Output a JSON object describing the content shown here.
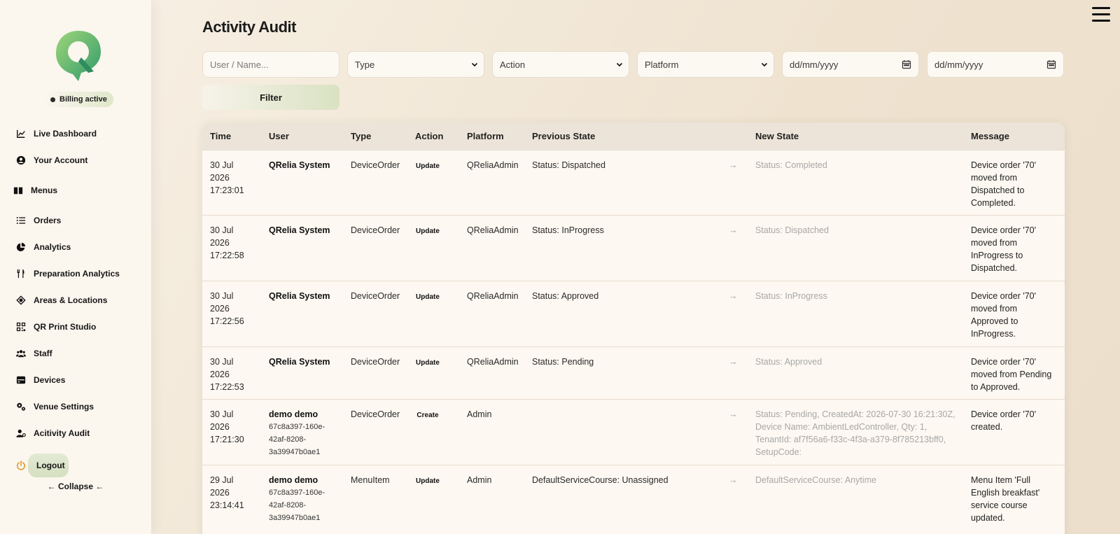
{
  "sidebar": {
    "billing_label": "Billing active",
    "nav": [
      {
        "label": "Live Dashboard",
        "icon": "chart-line-icon"
      },
      {
        "label": "Your Account",
        "icon": "user-circle-icon"
      },
      {
        "label": "Menus",
        "icon": "book-open-icon"
      },
      {
        "label": "Orders",
        "icon": "list-icon"
      },
      {
        "label": "Analytics",
        "icon": "pie-chart-icon"
      },
      {
        "label": "Preparation Analytics",
        "icon": "utensils-icon"
      },
      {
        "label": "Areas & Locations",
        "icon": "location-crosshair-icon"
      },
      {
        "label": "QR Print Studio",
        "icon": "qr-code-icon"
      },
      {
        "label": "Staff",
        "icon": "users-icon"
      },
      {
        "label": "Devices",
        "icon": "device-icon"
      },
      {
        "label": "Venue Settings",
        "icon": "gears-icon"
      },
      {
        "label": "Acitivity Audit",
        "icon": "user-audit-icon"
      },
      {
        "label": "Logout",
        "icon": "power-icon"
      }
    ],
    "collapse_label": "← Collapse ←"
  },
  "page": {
    "title": "Activity Audit"
  },
  "filters": {
    "user_placeholder": "User / Name...",
    "type_selected": "Type",
    "action_selected": "Action",
    "platform_selected": "Platform",
    "date_from_placeholder": "dd/mm/yyyy",
    "date_to_placeholder": "dd/mm/yyyy",
    "filter_button": "Filter"
  },
  "table": {
    "columns": [
      "Time",
      "User",
      "Type",
      "Action",
      "Platform",
      "Previous State",
      "New State",
      "Message"
    ],
    "arrow": "→",
    "rows": [
      {
        "time": [
          "30 Jul",
          "2026",
          "17:23:01"
        ],
        "user": "QRelia System",
        "user_id": [],
        "type": "DeviceOrder",
        "action": "Update",
        "platform": "QReliaAdmin",
        "previous": "Status: Dispatched",
        "new": "Status: Completed",
        "message": "Device order '70' moved from Dispatched to Completed."
      },
      {
        "time": [
          "30 Jul",
          "2026",
          "17:22:58"
        ],
        "user": "QRelia System",
        "user_id": [],
        "type": "DeviceOrder",
        "action": "Update",
        "platform": "QReliaAdmin",
        "previous": "Status: InProgress",
        "new": "Status: Dispatched",
        "message": "Device order '70' moved from InProgress to Dispatched."
      },
      {
        "time": [
          "30 Jul",
          "2026",
          "17:22:56"
        ],
        "user": "QRelia System",
        "user_id": [],
        "type": "DeviceOrder",
        "action": "Update",
        "platform": "QReliaAdmin",
        "previous": "Status: Approved",
        "new": "Status: InProgress",
        "message": "Device order '70' moved from Approved to InProgress."
      },
      {
        "time": [
          "30 Jul",
          "2026",
          "17:22:53"
        ],
        "user": "QRelia System",
        "user_id": [],
        "type": "DeviceOrder",
        "action": "Update",
        "platform": "QReliaAdmin",
        "previous": "Status: Pending",
        "new": "Status: Approved",
        "message": "Device order '70' moved from Pending to Approved."
      },
      {
        "time": [
          "30 Jul",
          "2026",
          "17:21:30"
        ],
        "user": "demo demo",
        "user_id": [
          "67c8a397-160e-",
          "42af-8208-",
          "3a39947b0ae1"
        ],
        "type": "DeviceOrder",
        "action": "Create",
        "platform": "Admin",
        "previous": "",
        "new": "Status: Pending, CreatedAt: 2026-07-30 16:21:30Z, Device Name: AmbientLedController, Qty: 1, TenantId: af7f56a6-f33c-4f3a-a379-8f785213bff0, SetupCode:",
        "message": "Device order '70' created."
      },
      {
        "time": [
          "29 Jul",
          "2026",
          "23:14:41"
        ],
        "user": "demo demo",
        "user_id": [
          "67c8a397-160e-",
          "42af-8208-",
          "3a39947b0ae1"
        ],
        "type": "MenuItem",
        "action": "Update",
        "platform": "Admin",
        "previous": "DefaultServiceCourse: Unassigned",
        "new": "DefaultServiceCourse: Anytime",
        "message": "Menu Item 'Full English breakfast' service course updated."
      }
    ]
  }
}
